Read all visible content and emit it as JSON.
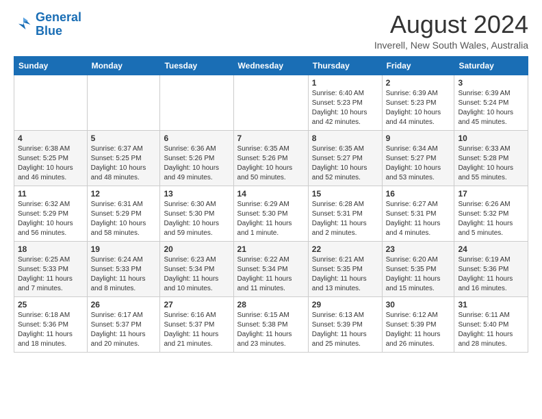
{
  "logo": {
    "text_general": "General",
    "text_blue": "Blue"
  },
  "header": {
    "month": "August 2024",
    "location": "Inverell, New South Wales, Australia"
  },
  "days_of_week": [
    "Sunday",
    "Monday",
    "Tuesday",
    "Wednesday",
    "Thursday",
    "Friday",
    "Saturday"
  ],
  "weeks": [
    [
      {
        "day": "",
        "info": ""
      },
      {
        "day": "",
        "info": ""
      },
      {
        "day": "",
        "info": ""
      },
      {
        "day": "",
        "info": ""
      },
      {
        "day": "1",
        "info": "Sunrise: 6:40 AM\nSunset: 5:23 PM\nDaylight: 10 hours\nand 42 minutes."
      },
      {
        "day": "2",
        "info": "Sunrise: 6:39 AM\nSunset: 5:23 PM\nDaylight: 10 hours\nand 44 minutes."
      },
      {
        "day": "3",
        "info": "Sunrise: 6:39 AM\nSunset: 5:24 PM\nDaylight: 10 hours\nand 45 minutes."
      }
    ],
    [
      {
        "day": "4",
        "info": "Sunrise: 6:38 AM\nSunset: 5:25 PM\nDaylight: 10 hours\nand 46 minutes."
      },
      {
        "day": "5",
        "info": "Sunrise: 6:37 AM\nSunset: 5:25 PM\nDaylight: 10 hours\nand 48 minutes."
      },
      {
        "day": "6",
        "info": "Sunrise: 6:36 AM\nSunset: 5:26 PM\nDaylight: 10 hours\nand 49 minutes."
      },
      {
        "day": "7",
        "info": "Sunrise: 6:35 AM\nSunset: 5:26 PM\nDaylight: 10 hours\nand 50 minutes."
      },
      {
        "day": "8",
        "info": "Sunrise: 6:35 AM\nSunset: 5:27 PM\nDaylight: 10 hours\nand 52 minutes."
      },
      {
        "day": "9",
        "info": "Sunrise: 6:34 AM\nSunset: 5:27 PM\nDaylight: 10 hours\nand 53 minutes."
      },
      {
        "day": "10",
        "info": "Sunrise: 6:33 AM\nSunset: 5:28 PM\nDaylight: 10 hours\nand 55 minutes."
      }
    ],
    [
      {
        "day": "11",
        "info": "Sunrise: 6:32 AM\nSunset: 5:29 PM\nDaylight: 10 hours\nand 56 minutes."
      },
      {
        "day": "12",
        "info": "Sunrise: 6:31 AM\nSunset: 5:29 PM\nDaylight: 10 hours\nand 58 minutes."
      },
      {
        "day": "13",
        "info": "Sunrise: 6:30 AM\nSunset: 5:30 PM\nDaylight: 10 hours\nand 59 minutes."
      },
      {
        "day": "14",
        "info": "Sunrise: 6:29 AM\nSunset: 5:30 PM\nDaylight: 11 hours\nand 1 minute."
      },
      {
        "day": "15",
        "info": "Sunrise: 6:28 AM\nSunset: 5:31 PM\nDaylight: 11 hours\nand 2 minutes."
      },
      {
        "day": "16",
        "info": "Sunrise: 6:27 AM\nSunset: 5:31 PM\nDaylight: 11 hours\nand 4 minutes."
      },
      {
        "day": "17",
        "info": "Sunrise: 6:26 AM\nSunset: 5:32 PM\nDaylight: 11 hours\nand 5 minutes."
      }
    ],
    [
      {
        "day": "18",
        "info": "Sunrise: 6:25 AM\nSunset: 5:33 PM\nDaylight: 11 hours\nand 7 minutes."
      },
      {
        "day": "19",
        "info": "Sunrise: 6:24 AM\nSunset: 5:33 PM\nDaylight: 11 hours\nand 8 minutes."
      },
      {
        "day": "20",
        "info": "Sunrise: 6:23 AM\nSunset: 5:34 PM\nDaylight: 11 hours\nand 10 minutes."
      },
      {
        "day": "21",
        "info": "Sunrise: 6:22 AM\nSunset: 5:34 PM\nDaylight: 11 hours\nand 11 minutes."
      },
      {
        "day": "22",
        "info": "Sunrise: 6:21 AM\nSunset: 5:35 PM\nDaylight: 11 hours\nand 13 minutes."
      },
      {
        "day": "23",
        "info": "Sunrise: 6:20 AM\nSunset: 5:35 PM\nDaylight: 11 hours\nand 15 minutes."
      },
      {
        "day": "24",
        "info": "Sunrise: 6:19 AM\nSunset: 5:36 PM\nDaylight: 11 hours\nand 16 minutes."
      }
    ],
    [
      {
        "day": "25",
        "info": "Sunrise: 6:18 AM\nSunset: 5:36 PM\nDaylight: 11 hours\nand 18 minutes."
      },
      {
        "day": "26",
        "info": "Sunrise: 6:17 AM\nSunset: 5:37 PM\nDaylight: 11 hours\nand 20 minutes."
      },
      {
        "day": "27",
        "info": "Sunrise: 6:16 AM\nSunset: 5:37 PM\nDaylight: 11 hours\nand 21 minutes."
      },
      {
        "day": "28",
        "info": "Sunrise: 6:15 AM\nSunset: 5:38 PM\nDaylight: 11 hours\nand 23 minutes."
      },
      {
        "day": "29",
        "info": "Sunrise: 6:13 AM\nSunset: 5:39 PM\nDaylight: 11 hours\nand 25 minutes."
      },
      {
        "day": "30",
        "info": "Sunrise: 6:12 AM\nSunset: 5:39 PM\nDaylight: 11 hours\nand 26 minutes."
      },
      {
        "day": "31",
        "info": "Sunrise: 6:11 AM\nSunset: 5:40 PM\nDaylight: 11 hours\nand 28 minutes."
      }
    ]
  ]
}
